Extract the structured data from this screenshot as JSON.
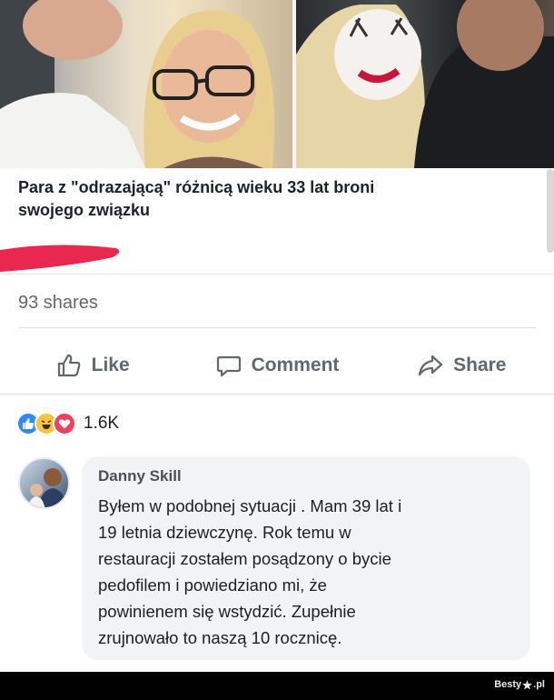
{
  "post": {
    "title_line1": "Para z \"odrazającą\" różnicą wieku 33 lat broni",
    "title_line2": "swojego związku",
    "shares": "93 shares"
  },
  "actions": {
    "like": "Like",
    "comment": "Comment",
    "share": "Share"
  },
  "reactions": {
    "icons": [
      "like-icon",
      "haha-icon",
      "love-icon"
    ],
    "count": "1.6K"
  },
  "comment": {
    "author": "Danny Skill",
    "lines": [
      "Byłem w podobnej sytuacji . Mam 39 lat i",
      "19 letnia dziewczynę. Rok temu w",
      "restauracji zostałem posądzony o bycie",
      "pedofilem i powiedziano mi, że",
      "powinienem się wstydzić. Zupełnie",
      "zrujnowało to naszą 10 rocznicę."
    ]
  },
  "footer": {
    "brand_prefix": "Besty",
    "brand_suffix": ".pl"
  },
  "colors": {
    "like_blue": "#2e89ff",
    "haha_yellow": "#f7c33b",
    "love_red": "#f0405e",
    "marker_red": "#e8284f",
    "action_grey": "#606770"
  }
}
